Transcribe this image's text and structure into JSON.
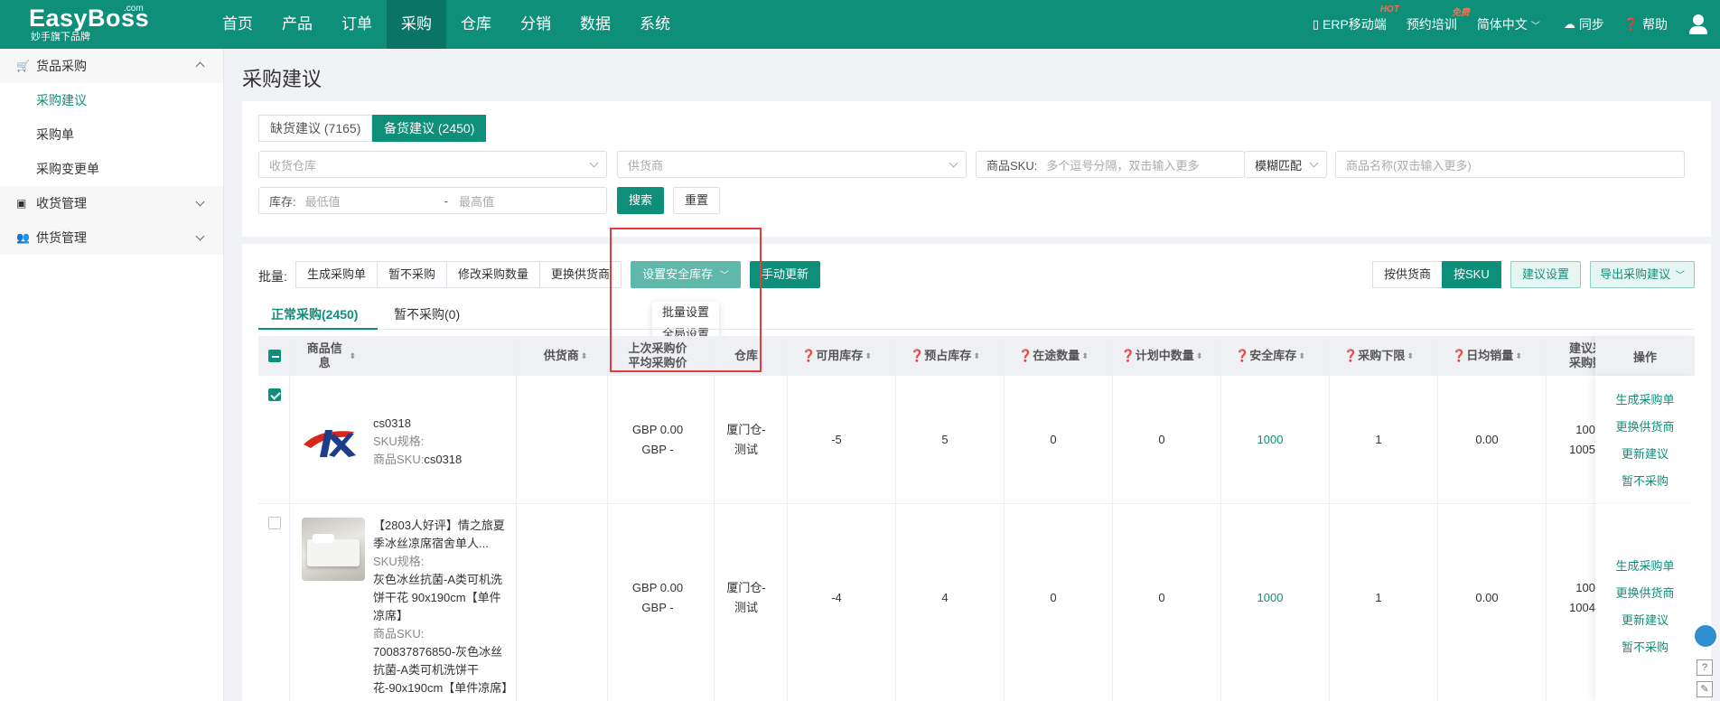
{
  "brand": {
    "name": "EasyBoss",
    "sup": ".com",
    "tagline": "妙手旗下品牌"
  },
  "nav": [
    "首页",
    "产品",
    "订单",
    "采购",
    "仓库",
    "分销",
    "数据",
    "系统"
  ],
  "top_right": {
    "erp": "ERP移动端",
    "erp_badge": "HOT",
    "training": "预约培训",
    "training_badge": "免费",
    "language": "简体中文",
    "sync": "同步",
    "help": "帮助"
  },
  "sidebar": {
    "group1": "货品采购",
    "items": [
      "采购建议",
      "采购单",
      "采购变更单"
    ],
    "group2": "收货管理",
    "group3": "供货管理"
  },
  "page_title": "采购建议",
  "filter": {
    "tab_shortage": "缺货建议 (7165)",
    "tab_stock": "备货建议 (2450)",
    "warehouse_placeholder": "收货仓库",
    "supplier_placeholder": "供货商",
    "sku_label": "商品SKU:",
    "sku_placeholder": "多个逗号分隔，双击输入更多",
    "match_mode": "模糊匹配",
    "name_placeholder": "商品名称(双击输入更多)",
    "stock_label": "库存:",
    "min_placeholder": "最低值",
    "range_sep": "-",
    "max_placeholder": "最高值",
    "search": "搜索",
    "reset": "重置"
  },
  "batch": {
    "label": "批量:",
    "buttons": [
      "生成采购单",
      "暂不采购",
      "修改采购数量",
      "更换供货商"
    ],
    "safety_stock": "设置安全库存",
    "manual_update": "手动更新",
    "dropdown": [
      "批量设置",
      "全局设置"
    ],
    "by_supplier": "按供货商",
    "by_sku": "按SKU",
    "suggest_settings": "建议设置",
    "export": "导出采购建议"
  },
  "subtabs": {
    "normal": "正常采购(2450)",
    "paused": "暂不采购(0)"
  },
  "columns": {
    "product": "商品信息",
    "supplier": "供货商",
    "last_price_1": "上次采购价",
    "last_price_2": "平均采购价",
    "warehouse": "仓库",
    "available": "❓可用库存",
    "reserved": "❓预占库存",
    "in_transit": "❓在途数量",
    "planned": "❓计划中数量",
    "safety": "❓安全库存",
    "lower_limit": "❓采购下限",
    "daily_sales": "❓日均销量",
    "suggest_1": "建议采",
    "suggest_2": "采购数",
    "ops": "操作"
  },
  "rows": [
    {
      "name": "cs0318",
      "sku_spec_label": "SKU规格:",
      "sku_spec": "",
      "sku_label": "商品SKU:",
      "sku": "cs0318",
      "price1": "GBP 0.00",
      "price2": "GBP -",
      "warehouse": "厦门仓-测试",
      "available": "-5",
      "reserved": "5",
      "in_transit": "0",
      "planned": "0",
      "safety": "1000",
      "lower_limit": "1",
      "daily_sales": "0.00",
      "suggest1": "100",
      "suggest2": "1005"
    },
    {
      "name": "【2803人好评】情之旅夏季冰丝凉席宿舍单人...",
      "sku_spec_label": "SKU规格:",
      "sku_spec": "灰色冰丝抗菌-A类可机洗饼干花 90x190cm【单件凉席】",
      "sku_label": "商品SKU:",
      "sku": "700837876850-灰色冰丝抗菌-A类可机洗饼干花-90x190cm【单件凉席】",
      "price1": "GBP 0.00",
      "price2": "GBP -",
      "warehouse": "厦门仓-测试",
      "available": "-4",
      "reserved": "4",
      "in_transit": "0",
      "planned": "0",
      "safety": "1000",
      "lower_limit": "1",
      "daily_sales": "0.00",
      "suggest1": "100",
      "suggest2": "1004"
    }
  ],
  "row_ops": [
    "生成采购单",
    "更换供货商",
    "更新建议",
    "暂不采购"
  ],
  "colors": {
    "primary": "#0e8f7a",
    "highlight_box": "#e83a3a"
  }
}
